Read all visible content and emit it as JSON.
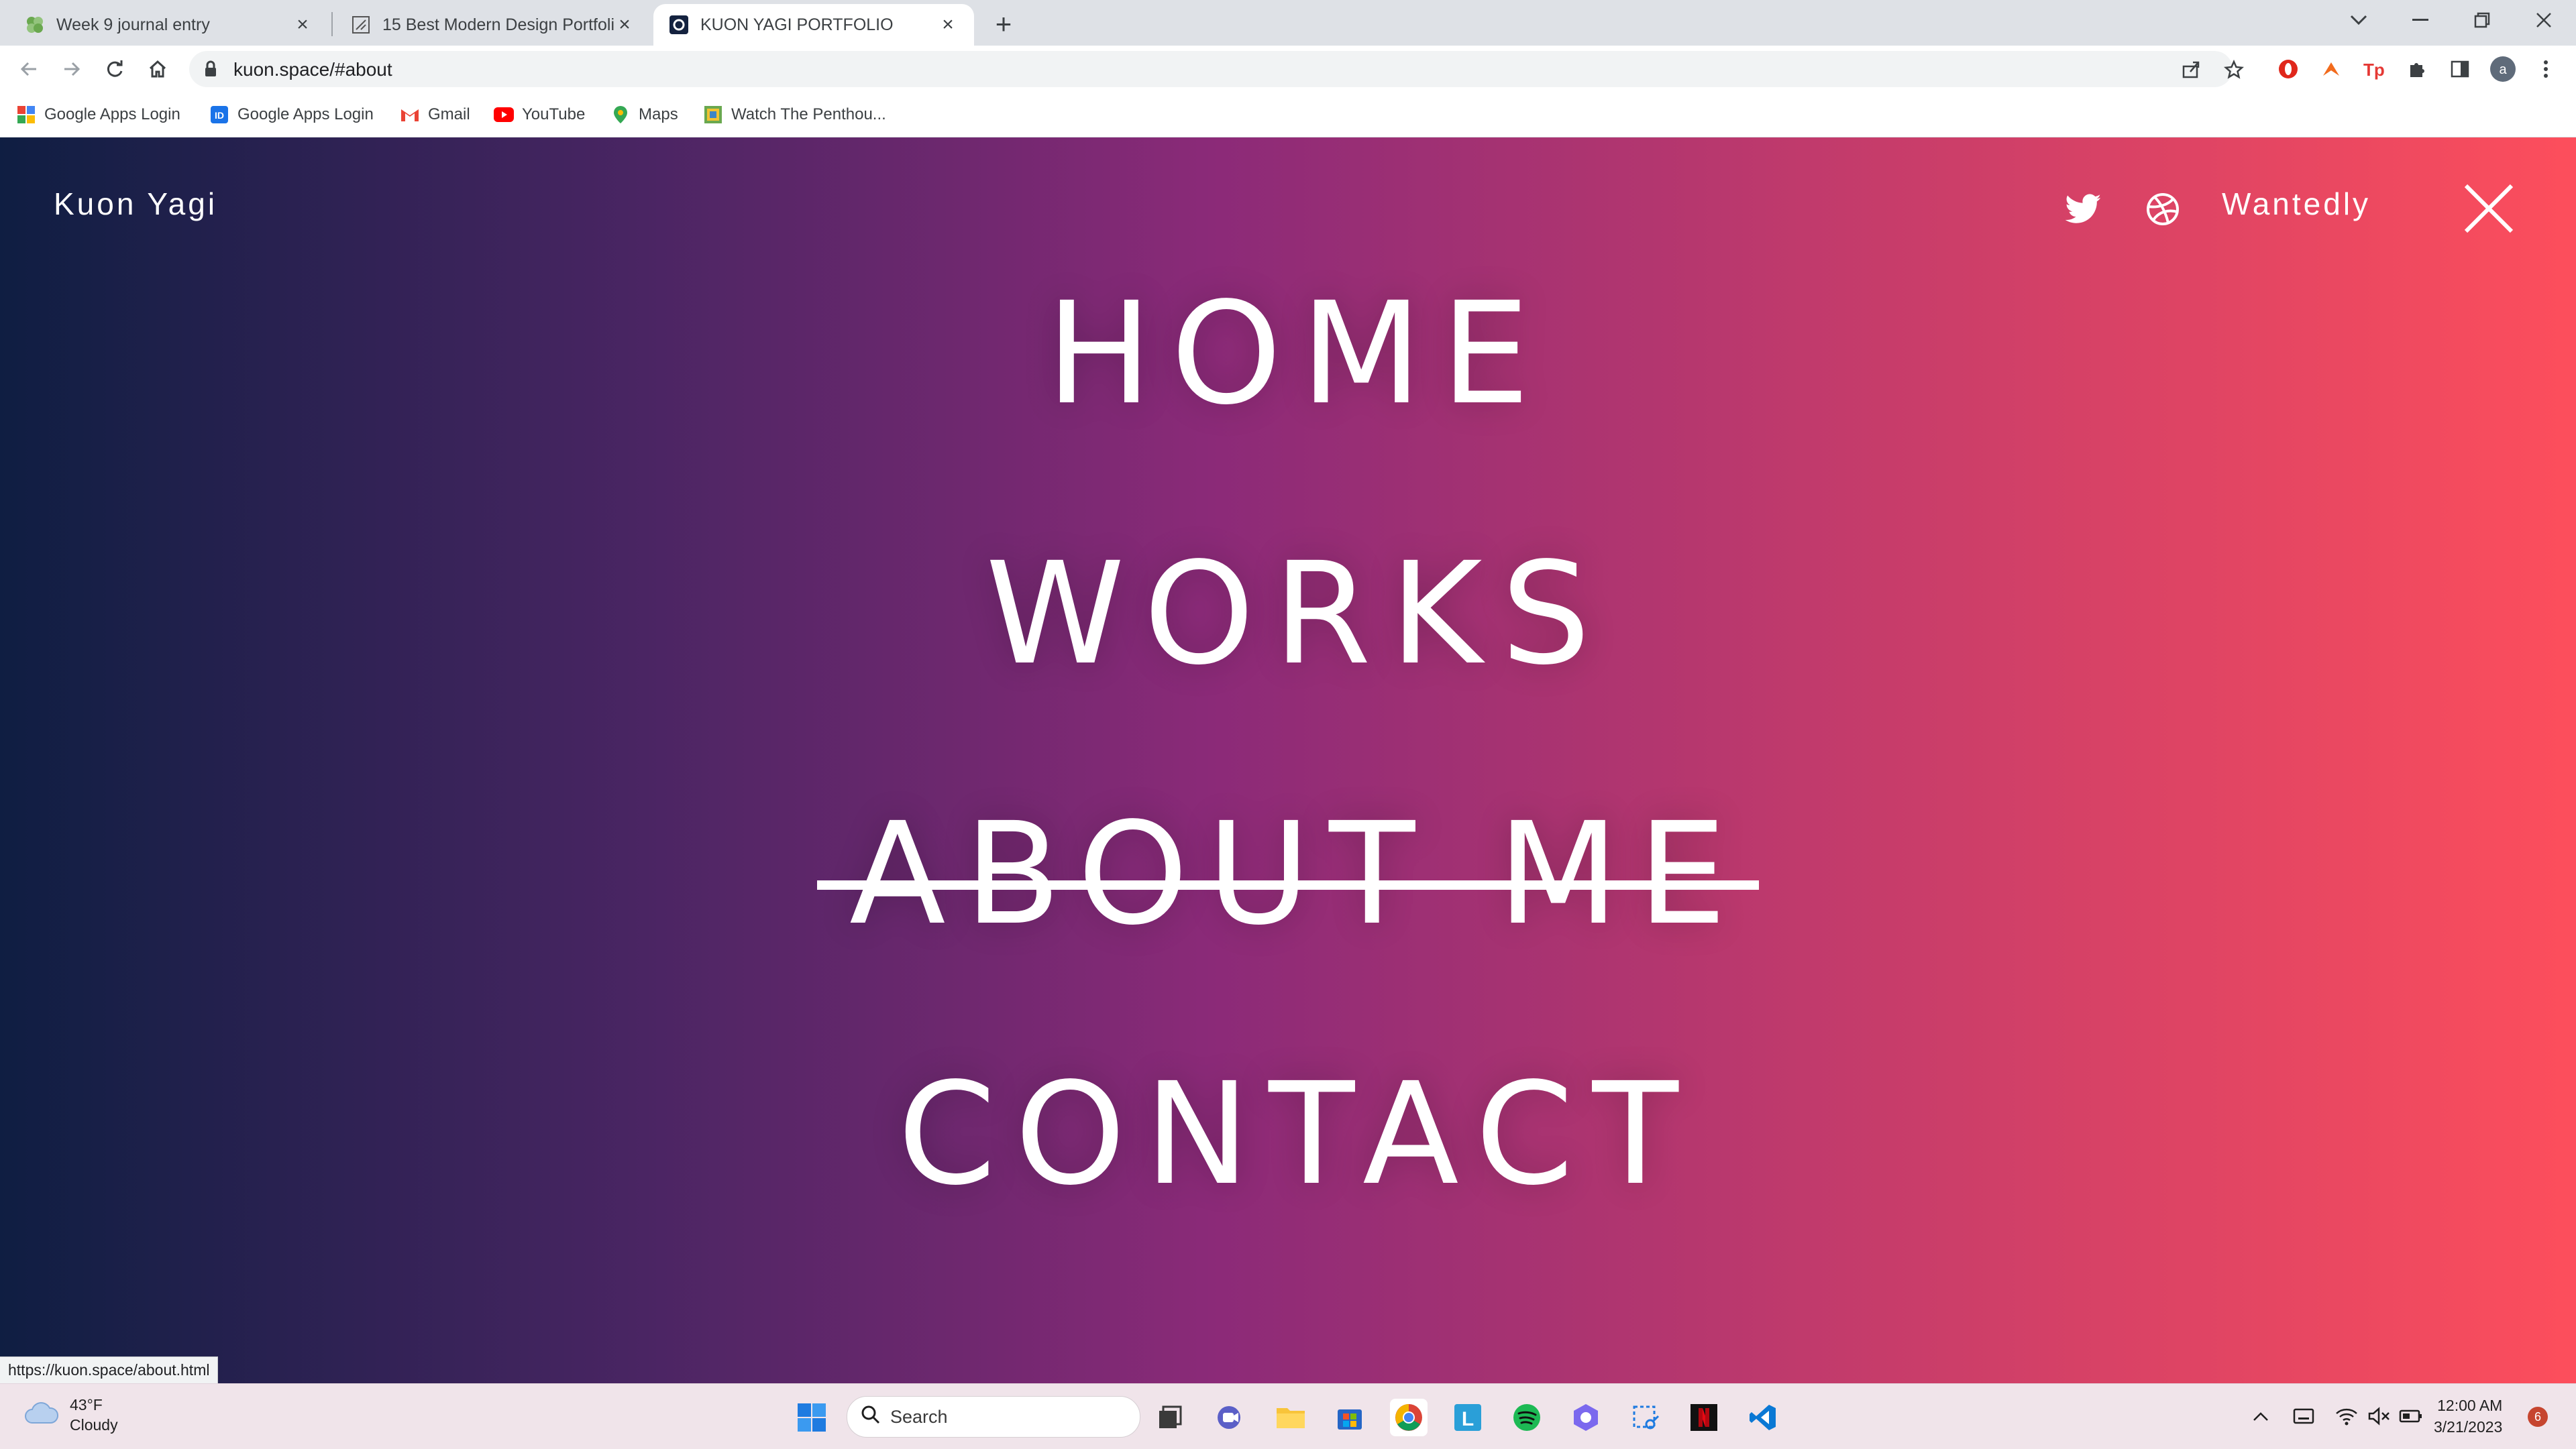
{
  "browser": {
    "tabs": [
      {
        "title": "Week 9 journal entry",
        "favicon": "green-leaf-icon",
        "active": false
      },
      {
        "title": "15 Best Modern Design Portfolio",
        "favicon": "pen-nib-icon",
        "active": false
      },
      {
        "title": "KUON YAGI PORTFOLIO",
        "favicon": "kuon-logo-icon",
        "active": true
      }
    ],
    "url": "kuon.space/#about",
    "bookmarks": [
      {
        "label": "Google Apps Login",
        "icon": "google-apps-icon"
      },
      {
        "label": "Google Apps Login",
        "icon": "id-badge-icon"
      },
      {
        "label": "Gmail",
        "icon": "gmail-icon"
      },
      {
        "label": "YouTube",
        "icon": "youtube-icon"
      },
      {
        "label": "Maps",
        "icon": "maps-pin-icon"
      },
      {
        "label": "Watch The Penthou...",
        "icon": "tv-show-icon"
      }
    ],
    "status_link": "https://kuon.space/about.html",
    "profile_initial": "a"
  },
  "site": {
    "logo": "Kuon Yagi",
    "wantedly": "Wantedly",
    "menu": [
      {
        "label": "HOME",
        "current": false
      },
      {
        "label": "WORKS",
        "current": false
      },
      {
        "label": "ABOUT ME",
        "current": true
      },
      {
        "label": "CONTACT",
        "current": false
      }
    ],
    "gradient": [
      "#0f1e42",
      "#8b2a78",
      "#fd4e5c"
    ]
  },
  "taskbar": {
    "weather_temp": "43°F",
    "weather_desc": "Cloudy",
    "search_label": "Search",
    "time": "12:00 AM",
    "date": "3/21/2023",
    "notification_count": "6"
  }
}
